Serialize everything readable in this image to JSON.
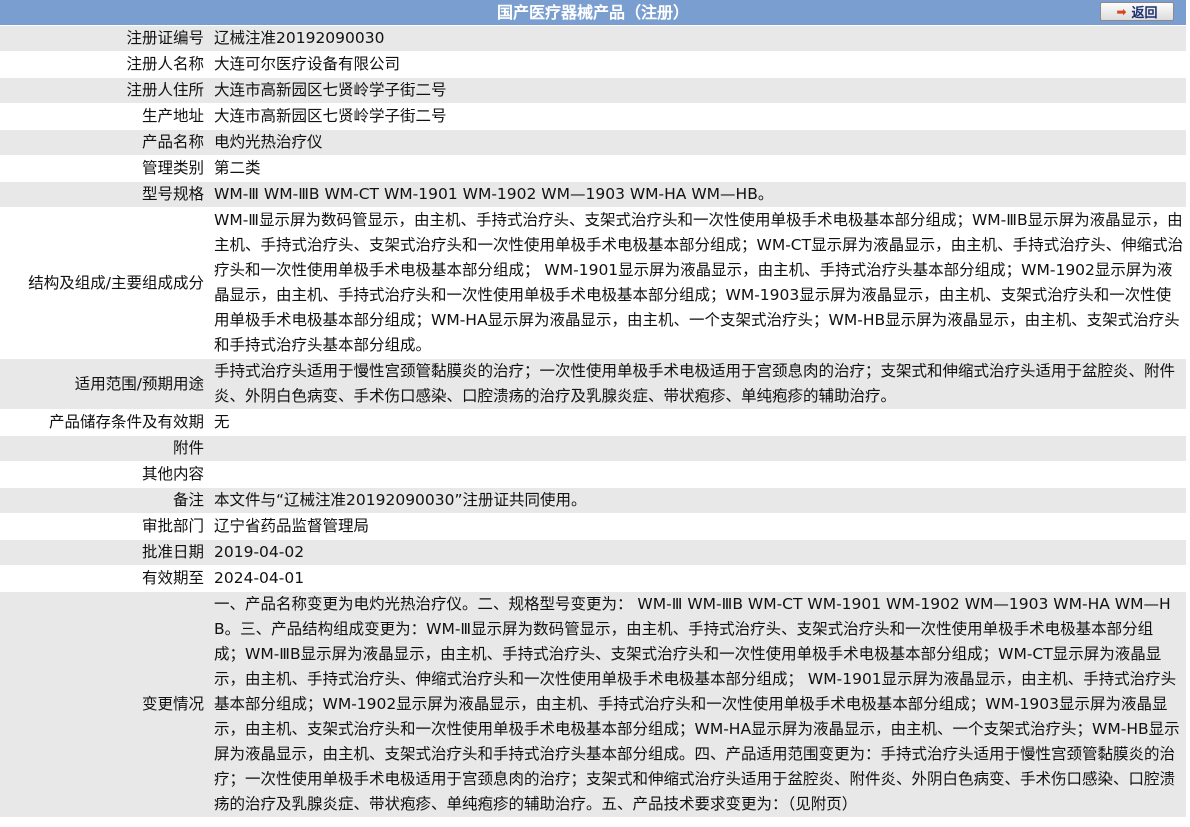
{
  "header": {
    "title": "国产医疗器械产品（注册）",
    "back_label": "返回"
  },
  "rows": [
    {
      "label": "注册证编号",
      "value": "辽械注准20192090030"
    },
    {
      "label": "注册人名称",
      "value": "大连可尔医疗设备有限公司"
    },
    {
      "label": "注册人住所",
      "value": "大连市高新园区七贤岭学子街二号"
    },
    {
      "label": "生产地址",
      "value": "大连市高新园区七贤岭学子街二号"
    },
    {
      "label": "产品名称",
      "value": "电灼光热治疗仪"
    },
    {
      "label": "管理类别",
      "value": "第二类"
    },
    {
      "label": "型号规格",
      "value": "WM-Ⅲ WM-ⅢB WM-CT WM-1901 WM-1902 WM—1903 WM-HA WM—HB。"
    },
    {
      "label": "结构及组成/主要组成成分",
      "value": "WM-Ⅲ显示屏为数码管显示，由主机、手持式治疗头、支架式治疗头和一次性使用单极手术电极基本部分组成；WM-ⅢB显示屏为液晶显示，由主机、手持式治疗头、支架式治疗头和一次性使用单极手术电极基本部分组成；WM-CT显示屏为液晶显示，由主机、手持式治疗头、伸缩式治疗头和一次性使用单极手术电极基本部分组成； WM-1901显示屏为液晶显示，由主机、手持式治疗头基本部分组成；WM-1902显示屏为液晶显示，由主机、手持式治疗头和一次性使用单极手术电极基本部分组成；WM-1903显示屏为液晶显示，由主机、支架式治疗头和一次性使用单极手术电极基本部分组成；WM-HA显示屏为液晶显示，由主机、一个支架式治疗头；WM-HB显示屏为液晶显示，由主机、支架式治疗头和手持式治疗头基本部分组成。"
    },
    {
      "label": "适用范围/预期用途",
      "value": "手持式治疗头适用于慢性宫颈管黏膜炎的治疗；一次性使用单极手术电极适用于宫颈息肉的治疗；支架式和伸缩式治疗头适用于盆腔炎、附件炎、外阴白色病变、手术伤口感染、口腔溃疡的治疗及乳腺炎症、带状疱疹、单纯疱疹的辅助治疗。"
    },
    {
      "label": "产品储存条件及有效期",
      "value": "无"
    },
    {
      "label": "附件",
      "value": ""
    },
    {
      "label": "其他内容",
      "value": ""
    },
    {
      "label": "备注",
      "value": "本文件与“辽械注准20192090030”注册证共同使用。"
    },
    {
      "label": "审批部门",
      "value": "辽宁省药品监督管理局"
    },
    {
      "label": "批准日期",
      "value": "2019-04-02"
    },
    {
      "label": "有效期至",
      "value": "2024-04-01"
    },
    {
      "label": "变更情况",
      "value": "一、产品名称变更为电灼光热治疗仪。二、规格型号变更为： WM-Ⅲ WM-ⅢB WM-CT WM-1901 WM-1902 WM—1903 WM-HA WM—HB。三、产品结构组成变更为：WM-Ⅲ显示屏为数码管显示，由主机、手持式治疗头、支架式治疗头和一次性使用单极手术电极基本部分组成；WM-ⅢB显示屏为液晶显示，由主机、手持式治疗头、支架式治疗头和一次性使用单极手术电极基本部分组成；WM-CT显示屏为液晶显示，由主机、手持式治疗头、伸缩式治疗头和一次性使用单极手术电极基本部分组成； WM-1901显示屏为液晶显示，由主机、手持式治疗头基本部分组成；WM-1902显示屏为液晶显示，由主机、手持式治疗头和一次性使用单极手术电极基本部分组成；WM-1903显示屏为液晶显示，由主机、支架式治疗头和一次性使用单极手术电极基本部分组成；WM-HA显示屏为液晶显示，由主机、一个支架式治疗头；WM-HB显示屏为液晶显示，由主机、支架式治疗头和手持式治疗头基本部分组成。四、产品适用范围变更为：手持式治疗头适用于慢性宫颈管黏膜炎的治疗；一次性使用单极手术电极适用于宫颈息肉的治疗；支架式和伸缩式治疗头适用于盆腔炎、附件炎、外阴白色病变、手术伤口感染、口腔溃疡的治疗及乳腺炎症、带状疱疹、单纯疱疹的辅助治疗。五、产品技术要求变更为：（见附页）"
    }
  ]
}
